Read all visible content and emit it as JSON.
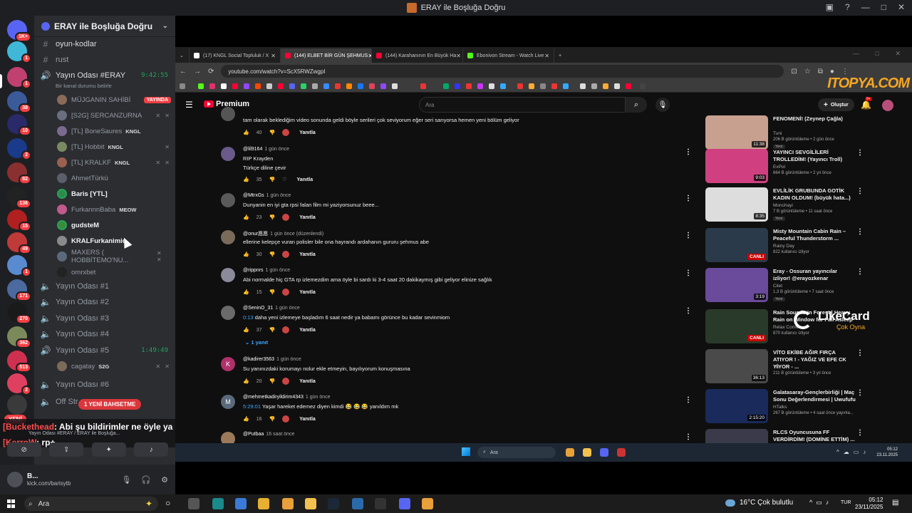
{
  "window": {
    "title": "ERAY ile Boşluğa Doğru"
  },
  "rail": {
    "badges": [
      "1K+",
      "1",
      "1",
      "38",
      "10",
      "2",
      "82",
      "136",
      "15",
      "49",
      "1",
      "171",
      "270",
      "362",
      "513",
      "2"
    ],
    "new_label": "YENİ"
  },
  "server": {
    "name": "ERAY ile Boşluğa Doğru",
    "text_channels": [
      "oyun-kodlar",
      "rust"
    ],
    "active_voice": {
      "name": "Yayın Odası #ERAY",
      "time": "9:42:55",
      "status": "Bir kanal durumu belirle"
    },
    "members": [
      {
        "name": "MÜJGANIN SAHİBİ",
        "live": "YAYINDA",
        "color": "#8a6a5a"
      },
      {
        "name": "[S2G] SERCANZURNA",
        "color": "#6a6f80",
        "mute": "✕ ✕"
      },
      {
        "name": "[TL] BoneSaures",
        "tag": "KNGL",
        "color": "#7a6a90"
      },
      {
        "name": "[TL] Hobbit",
        "tag": "KNGL",
        "color": "#7a8a60",
        "mute": "✕"
      },
      {
        "name": "[TL] KRALKF",
        "tag": "KNGL",
        "color": "#9a6050",
        "mute": "✕ ✕"
      },
      {
        "name": "AhmetTürkü",
        "color": "#5a5f6a"
      },
      {
        "name": "Baris [YTL]",
        "color": "#2f8a4a"
      },
      {
        "name": "FurkannnBaba",
        "tag": "MEOW",
        "color": "#c05a8a"
      },
      {
        "name": "gudsteM",
        "color": "#3a8a3a"
      },
      {
        "name": "KRALFurkanimio",
        "color": "#8a8a8a"
      },
      {
        "name": "MAXERS ( HOBBİTEMO'NU...",
        "color": "#5a6a7a",
        "mute": "✕ ✕"
      },
      {
        "name": "omrxbet",
        "color": "#222"
      }
    ],
    "voice_channels": [
      {
        "name": "Yayın Odası #1"
      },
      {
        "name": "Yayın Odası #2"
      },
      {
        "name": "Yayın Odası #3"
      },
      {
        "name": "Yayın Odası #4"
      },
      {
        "name": "Yayın Odası #5",
        "time": "1:49:49"
      },
      {
        "name": "Yayın Odası #6"
      },
      {
        "name": "Off Str"
      }
    ],
    "voice5_member": {
      "name": "cagatay",
      "tag": "S2G",
      "mute": "✕ ✕"
    },
    "yayin_badge": "1 YENİ BAHSETME"
  },
  "overlay_chat": {
    "line1_name": "[Buckethead",
    "line1_text": ": Abi şu bildirimler ne öyle ya",
    "line2_name": "[KerroW",
    "line2_text": ": rp+",
    "sub": "Yayın Odası #ERAY / ERAY ile Boşluğa..."
  },
  "userbar": {
    "name": "B...",
    "status": "kick.com/barisytb"
  },
  "browser": {
    "tabs": [
      {
        "title": "(17) KNGL Social Topluluk / X",
        "color": "#fff"
      },
      {
        "title": "(144) ELBET BİR GÜN ŞEHMUS",
        "color": "#ff0033",
        "active": true
      },
      {
        "title": "(144) Karahanının En Büyük Ha",
        "color": "#ff0033"
      },
      {
        "title": "Ebonivon Stream - Watch Live",
        "color": "#53fc18"
      }
    ],
    "url": "youtube.com/watch?v=ScX5RWZwgpI",
    "watermark": "ITOPYA.COM"
  },
  "youtube": {
    "logo": "Premium",
    "search_placeholder": "Ara",
    "create_label": "Oluştur",
    "bell_badge": "9+",
    "replies_link": "1 yanıt",
    "comments": [
      {
        "author": "",
        "time": "",
        "text": "tam olarak beklediğim video sonunda geldi böyle serileri çok seviyorum eğer seri sarıyorsa hemen yeni bölüm geliyor",
        "likes": "40",
        "reply": "Yanıtla",
        "av": "#555"
      },
      {
        "author": "@lil9164",
        "time": "1 gün önce",
        "text": "RIP Krayden",
        "text2": "Türkçe diline çevir",
        "likes": "35",
        "reply": "Yanıtla",
        "av": "#6a5a8a"
      },
      {
        "author": "@MtrxGs",
        "time": "1 gün önce",
        "text": "Dunyanin en iyi gta rpsi falan film mi yaziyorsunuz beee...",
        "likes": "23",
        "reply": "Yanıtla",
        "av": "#5a5a5a"
      },
      {
        "author": "@onur愿愿",
        "time": "1 gün önce (düzenlendi)",
        "text": "ellerine kelepçe vuran polisler bile ona hayrandı ardahanın gururu şehmus abe",
        "likes": "30",
        "reply": "Yanıtla",
        "av": "#7a6a5a"
      },
      {
        "author": "@rippnrs",
        "time": "1 gün önce",
        "text": "Abi normalde hiç GTA rp izlemezdim ama öyle bi sardı ki 3-4 saat 20 dakikaymış gibi geliyor elinize sağlık",
        "likes": "15",
        "reply": "Yanıtla",
        "av": "#8a8a9a"
      },
      {
        "author": "@SeninO_31",
        "time": "1 gün önce",
        "ts": "0:13",
        "text": " daha yeni izlemeye başladım 6 saat nedir ya babamı görünce bu kadar sevinmiom",
        "likes": "37",
        "reply": "Yanıtla",
        "av": "#6a6a6a"
      },
      {
        "author": "@kadirer3563",
        "time": "1 gün önce",
        "text": "Su yanınızdaki korumayı nolur ekle etmeyin, bayılıyorum konuşmasına",
        "likes": "20",
        "reply": "Yanıtla",
        "av": "#b0306a",
        "initial": "K"
      },
      {
        "author": "@mehmetkadiryildirim4343",
        "time": "1 gün önce",
        "ts": "5:29:01",
        "text": " Yaşar hareket edemez diyen kimdi 😂 😂 😂 yanıldım mk",
        "likes": "16",
        "reply": "Yanıtla",
        "av": "#5a6a7a",
        "initial": "M"
      },
      {
        "author": "@Putbaa",
        "time": "16 saat önce",
        "text": "",
        "likes": "",
        "reply": "",
        "av": "#9a7a5a"
      }
    ],
    "sidebar": [
      {
        "title": "FENOMENİ! (Zeynep Çağla)",
        "channel": "Tuni",
        "meta": "206 B görüntüleme • 2 gün önce",
        "new": "Yeni",
        "dur": "11:38",
        "bg": "#c8a090"
      },
      {
        "title": "YAYINCI SEVGİLİLERİ TROLLEDİM! (Yayıncı Troll)",
        "channel": "ExPol",
        "meta": "664 B görüntüleme • 2 yıl önce",
        "dur": "9:03",
        "bg": "#d04080"
      },
      {
        "title": "EVLİLİK GRUBUNDA GOTİK KADIN OLDUM! (büyük hata...)",
        "channel": "Monchayi",
        "meta": "7 B görüntüleme • 11 saat önce",
        "new": "Yeni",
        "dur": "8:35",
        "bg": "#ddd"
      },
      {
        "title": "Misty Mountain Cabin Rain – Peaceful Thunderstorm ...",
        "channel": "Rainy Day",
        "meta": "822 kullanıcı izliyor",
        "live": "CANLI",
        "bg": "#2a3a4a"
      },
      {
        "title": "Eray - Ossuran yayıncılar izliyor! @erayozkenar",
        "channel": "Cilet",
        "meta": "1,3 B görüntüleme • 7 saat önce",
        "new": "Yeni",
        "dur": "3:19",
        "bg": "#6a4a9a"
      },
      {
        "title": "Rain Sounds in Forest | Heavy Rain on Window for Fall Asleep",
        "channel": "Relax Corner",
        "meta": "870 kullanıcı izliyor",
        "live": "CANLI",
        "bg": "#2a3a2a"
      },
      {
        "title": "VİTO EKİBE AĞIR FIRÇA ATIYOR ! - YAĞIZ VE EFE CK YİYOR - ...",
        "channel": "TÜ",
        "meta": "211 B görüntüleme • 3 yıl önce",
        "dur": "36:13",
        "bg": "#4a4a4a"
      },
      {
        "title": "Galatasaray-Gençlerbirliği | Maç Sonu Değerlendirmesi | Uwufufu",
        "channel": "HTalks",
        "meta": "267 B görüntüleme • 4 saat önce yayınla...",
        "dur": "2:15:20",
        "bg": "#1a2a5a"
      },
      {
        "title": "RLCS Oyuncusuna FF VERDİRDİM! (DOMİNE ETTİM) ...",
        "channel": "",
        "meta": "",
        "bg": "#3a3a4a"
      }
    ],
    "likecard": {
      "word": "LikeCard",
      "tagline": "Çok Oyna"
    }
  },
  "inner_taskbar": {
    "search": "Ara",
    "time": "05:12",
    "date": "23.11.2025"
  },
  "taskbar": {
    "search": "Ara",
    "weather": "16°C  Çok bulutlu",
    "lang": "TUR",
    "time": "05:12",
    "date": "23/11/2025"
  }
}
